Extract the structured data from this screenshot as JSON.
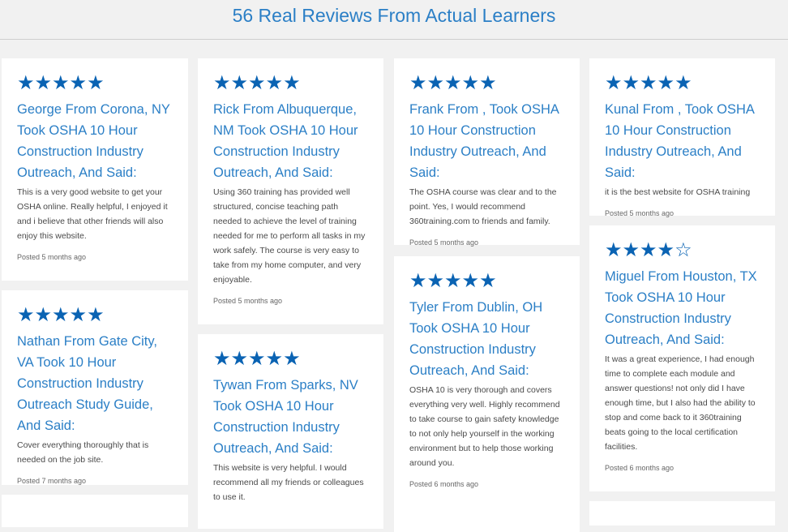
{
  "page_title": "56 Real Reviews From Actual Learners",
  "star_color": "#0a63b3",
  "title_color": "#2b7fc6",
  "reviews": [
    {
      "stars": "★★★★★",
      "title": "George From Corona, NY Took OSHA 10 Hour Construction Industry Outreach, And Said:",
      "body": "This is a very good website to get your OSHA online. Really helpful, I enjoyed it and i believe that other friends will also enjoy this website.",
      "posted": "Posted 5 months ago"
    },
    {
      "stars": "★★★★★",
      "title": "Nathan From Gate City, VA Took 10 Hour Construction Industry Outreach Study Guide, And Said:",
      "body": "Cover everything thoroughly that is needed on the job site.",
      "posted": "Posted 7 months ago"
    },
    {
      "stars": "★★★★★",
      "title": "Rick From Albuquerque, NM Took OSHA 10 Hour Construction Industry Outreach, And Said:",
      "body": "Using 360 training has provided well structured, concise teaching path needed to achieve the level of training needed for me to perform all tasks in my work safely. The course is very easy to take from my home computer, and very enjoyable.",
      "posted": "Posted 5 months ago"
    },
    {
      "stars": "★★★★★",
      "title": "Tywan From Sparks, NV Took OSHA 10 Hour Construction Industry Outreach, And Said:",
      "body": "This website is very helpful. I would recommend all my friends or colleagues to use it.",
      "posted": ""
    },
    {
      "stars": "★★★★★",
      "title": "Frank From , Took OSHA 10 Hour Construction Industry Outreach, And Said:",
      "body": "The OSHA course was clear and to the point. Yes, I would recommend 360training.com to friends and family.",
      "posted": "Posted 5 months ago"
    },
    {
      "stars": "★★★★★",
      "title": "Tyler From Dublin, OH Took OSHA 10 Hour Construction Industry Outreach, And Said:",
      "body": "OSHA 10 is very thorough and covers everything very well. Highly recommend to take course to gain safety knowledge to not only help yourself in the working environment but to help those working around you.",
      "posted": "Posted 6 months ago"
    },
    {
      "stars": "★★★★★",
      "title": "Kunal From , Took OSHA 10 Hour Construction Industry Outreach, And Said:",
      "body": "it is the best website for OSHA training",
      "posted": "Posted 5 months ago"
    },
    {
      "stars": "★★★★☆",
      "title": "Miguel From Houston, TX Took OSHA 10 Hour Construction Industry Outreach, And Said:",
      "body": "It was a great experience, I had enough time to complete each module and answer questions! not only did I have enough time, but I also had the ability to stop and come back to it 360training beats going to the local certification facilities.",
      "posted": "Posted 6 months ago"
    }
  ]
}
